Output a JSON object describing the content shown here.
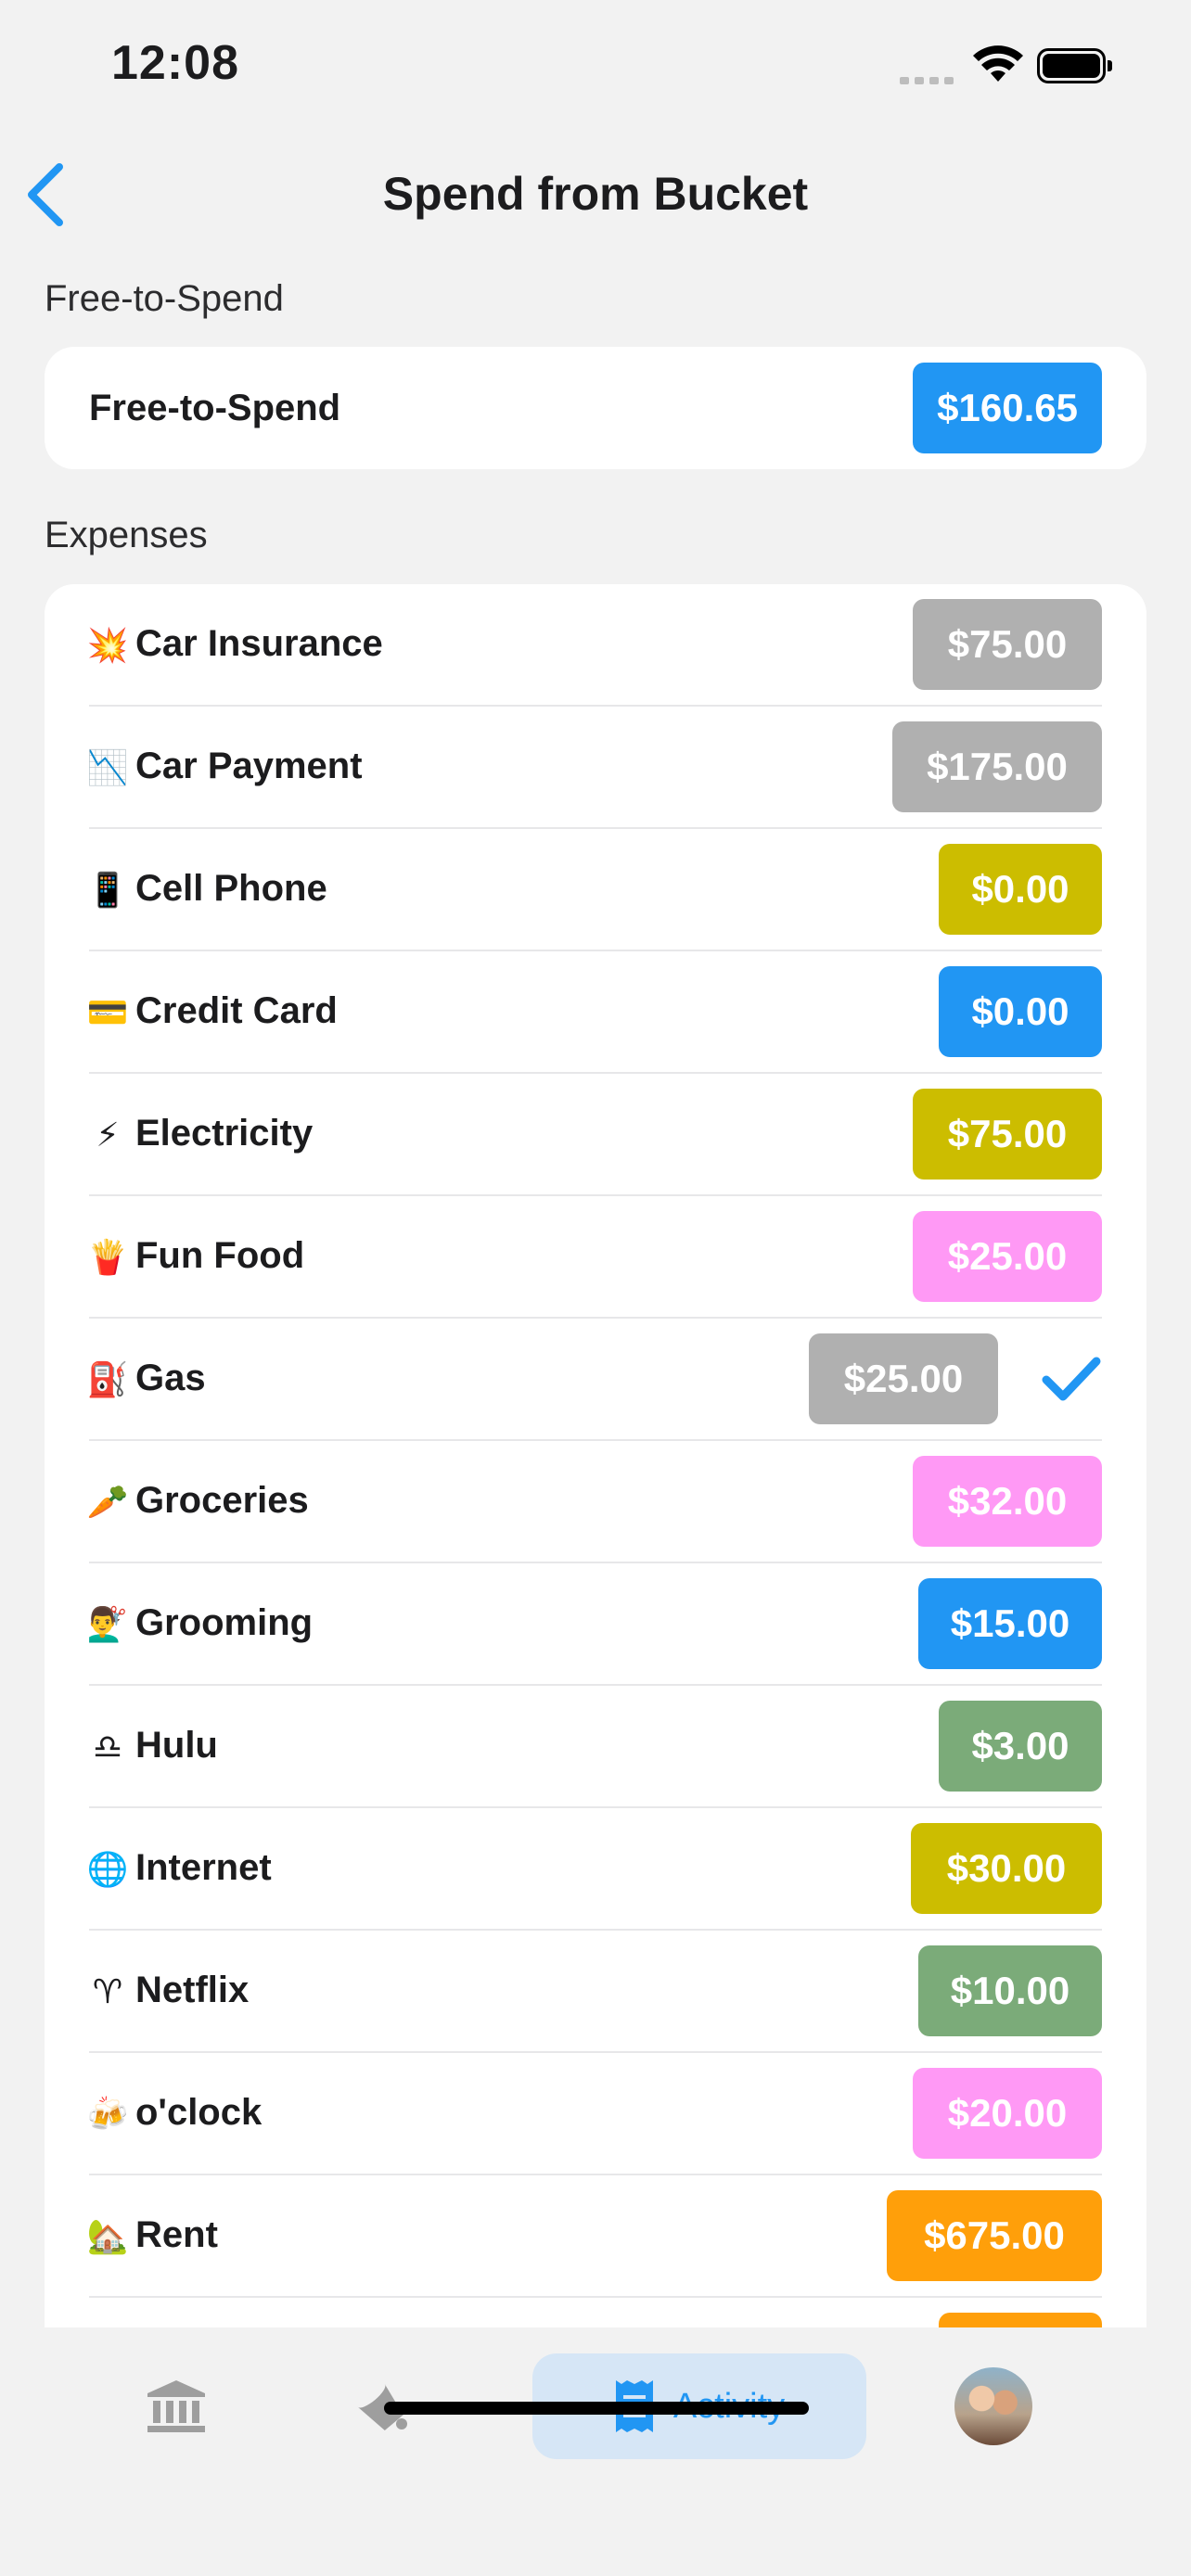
{
  "status_bar": {
    "time": "12:08"
  },
  "nav": {
    "title": "Spend from Bucket"
  },
  "free_to_spend": {
    "section_label": "Free-to-Spend",
    "row_label": "Free-to-Spend",
    "amount": "$160.65",
    "color": "#2196f3"
  },
  "expenses": {
    "section_label": "Expenses",
    "items": [
      {
        "emoji": "💥",
        "label": "Car Insurance",
        "amount": "$75.00",
        "color": "#b0b0b0"
      },
      {
        "emoji": "📉",
        "label": "Car Payment",
        "amount": "$175.00",
        "color": "#b0b0b0"
      },
      {
        "emoji": "📱",
        "label": "Cell Phone",
        "amount": "$0.00",
        "color": "#ccbd00"
      },
      {
        "emoji": "💳",
        "label": "Credit Card",
        "amount": "$0.00",
        "color": "#2196f3"
      },
      {
        "emoji": "⚡",
        "label": "Electricity",
        "amount": "$75.00",
        "color": "#ccbd00"
      },
      {
        "emoji": "🍟",
        "label": "Fun Food",
        "amount": "$25.00",
        "color": "#ff99f5"
      },
      {
        "emoji": "⛽",
        "label": "Gas",
        "amount": "$25.00",
        "color": "#b0b0b0",
        "selected": true
      },
      {
        "emoji": "🥕",
        "label": "Groceries",
        "amount": "$32.00",
        "color": "#ff99f5"
      },
      {
        "emoji": "💇‍♂️",
        "label": "Grooming",
        "amount": "$15.00",
        "color": "#2196f3"
      },
      {
        "emoji": "♎",
        "label": "Hulu",
        "amount": "$3.00",
        "color": "#7bab79"
      },
      {
        "emoji": "🌐",
        "label": "Internet",
        "amount": "$30.00",
        "color": "#ccbd00"
      },
      {
        "emoji": "♈",
        "label": "Netflix",
        "amount": "$10.00",
        "color": "#7bab79"
      },
      {
        "emoji": "🍻",
        "label": "o'clock",
        "amount": "$20.00",
        "color": "#ff99f5"
      },
      {
        "emoji": "🏡",
        "label": "Rent",
        "amount": "$675.00",
        "color": "#ff9f0a"
      },
      {
        "emoji": "",
        "label": "",
        "amount": "",
        "color": "#ff9f0a"
      }
    ]
  },
  "tabbar": {
    "tabs": [
      {
        "icon": "bank-icon",
        "label": ""
      },
      {
        "icon": "bucket-icon",
        "label": ""
      },
      {
        "icon": "receipt-icon",
        "label": "Activity",
        "active": true
      },
      {
        "icon": "profile-avatar",
        "label": ""
      }
    ],
    "accent": "#2196f3"
  }
}
